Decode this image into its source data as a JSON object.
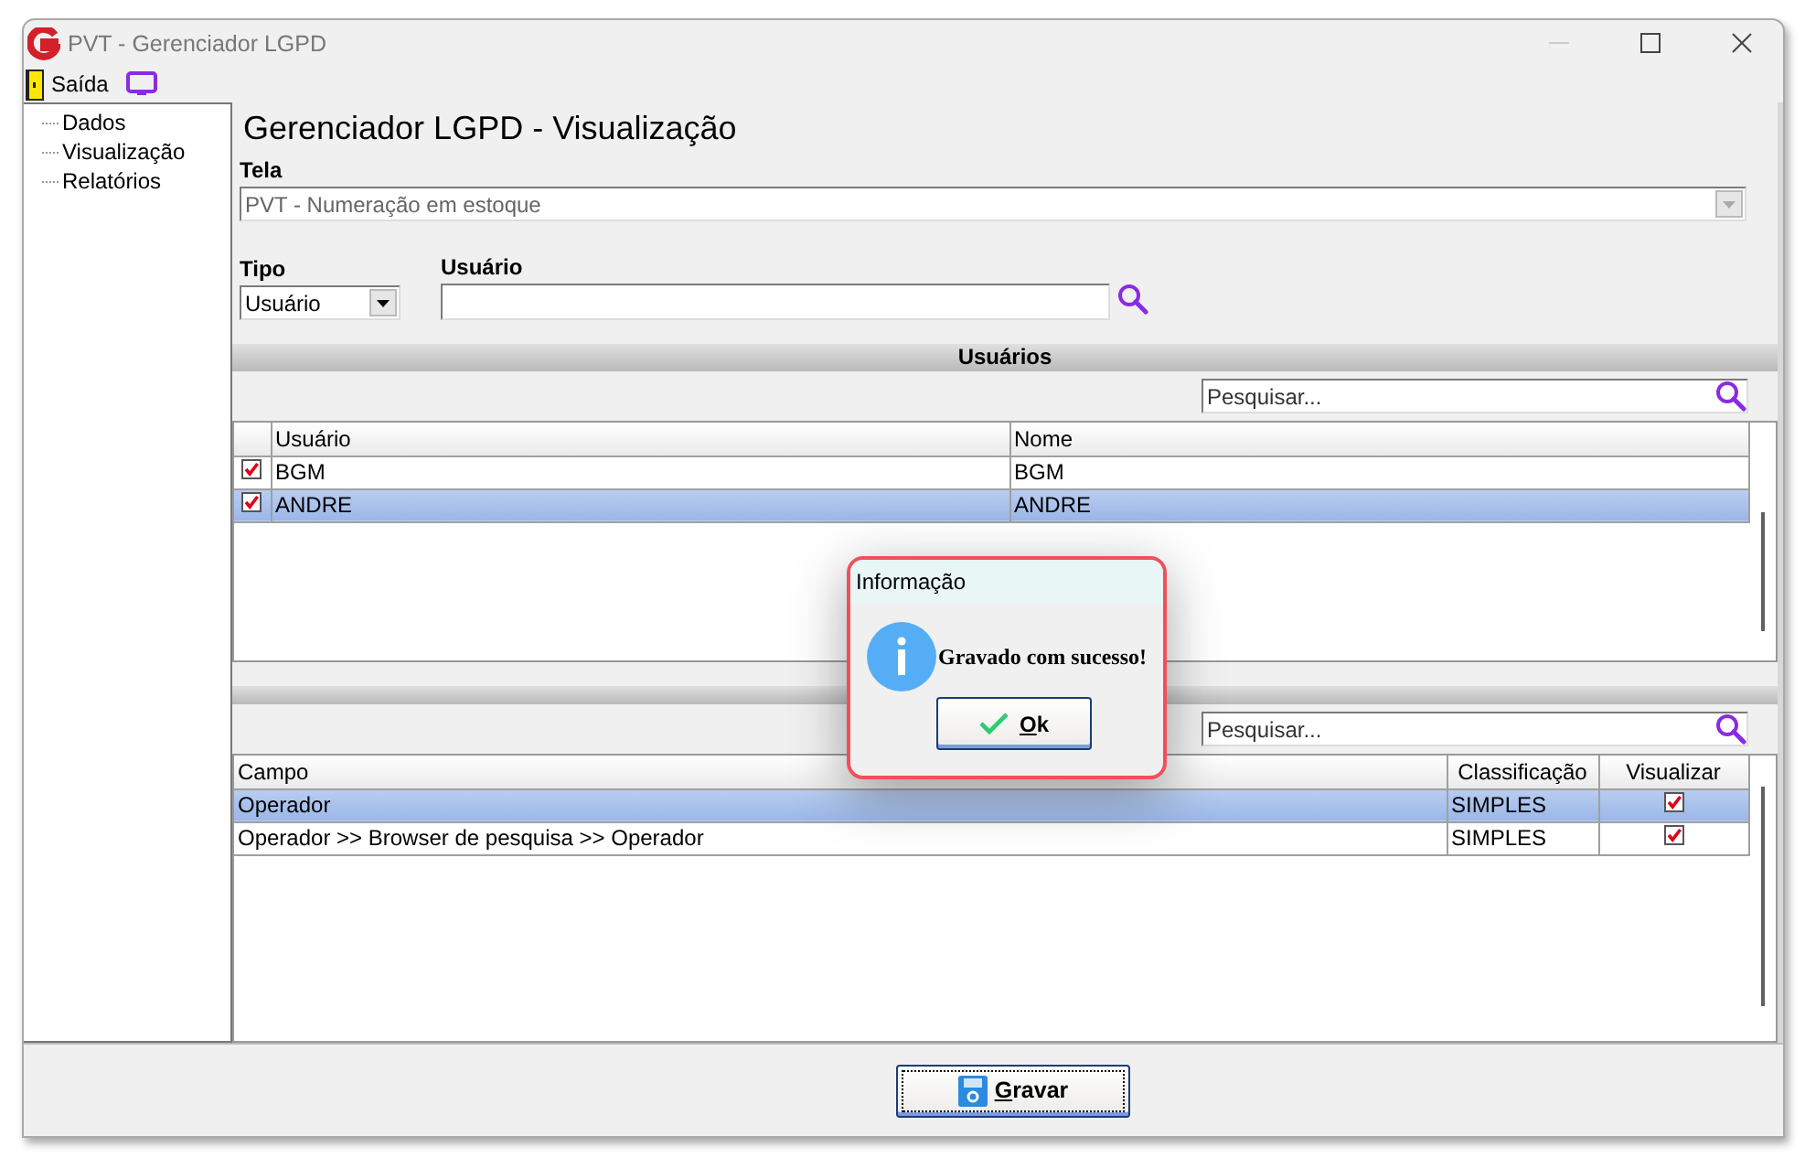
{
  "window": {
    "title": "PVT - Gerenciador LGPD"
  },
  "toolbar": {
    "exit_label": "Saída"
  },
  "sidebar": {
    "items": [
      {
        "label": "Dados"
      },
      {
        "label": "Visualização"
      },
      {
        "label": "Relatórios"
      }
    ]
  },
  "heading": "Gerenciador LGPD - Visualização",
  "tela": {
    "label": "Tela",
    "value": "PVT - Numeração em estoque"
  },
  "tipo": {
    "label": "Tipo",
    "value": "Usuário"
  },
  "usuario": {
    "label": "Usuário"
  },
  "users_section": {
    "title": "Usuários",
    "search_placeholder": "Pesquisar...",
    "columns": [
      "Usuário",
      "Nome"
    ],
    "rows": [
      {
        "checked": true,
        "selected": false,
        "cells": [
          "BGM",
          "BGM"
        ]
      },
      {
        "checked": true,
        "selected": true,
        "cells": [
          "ANDRE",
          "ANDRE"
        ]
      }
    ]
  },
  "fields_section": {
    "search_placeholder": "Pesquisar...",
    "columns": [
      "Campo",
      "Classificação",
      "Visualizar"
    ],
    "rows": [
      {
        "selected": true,
        "visible": true,
        "cells": [
          "Operador",
          "SIMPLES"
        ]
      },
      {
        "selected": false,
        "visible": true,
        "cells": [
          "Operador >> Browser de pesquisa >> Operador",
          "SIMPLES"
        ]
      }
    ]
  },
  "dialog": {
    "title": "Informação",
    "message": "Gravado com sucesso!",
    "button": "Ok"
  },
  "save_button": "Gravar"
}
